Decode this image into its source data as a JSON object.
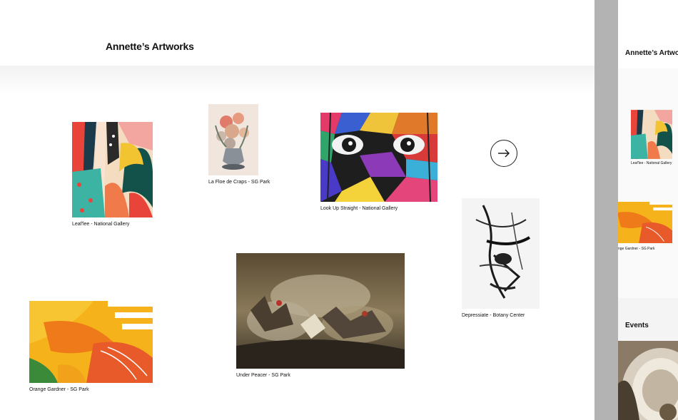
{
  "main": {
    "title": "Annette’s Artworks",
    "artworks": [
      {
        "title": "Leaf'lee",
        "location": "National Gallery",
        "caption": "Leaf'lee -  National Gallery"
      },
      {
        "title": "La Floe de Craps",
        "location": "SG Park",
        "caption": "La Floe de Craps -  SG Park"
      },
      {
        "title": "Look Up Straight",
        "location": "National Gallery",
        "caption": "Look Up Straight -  National Gallery"
      },
      {
        "title": "Depressiate",
        "location": "Botany Center",
        "caption": "Depressiate - Botany Center"
      },
      {
        "title": "Under Peacer",
        "location": "SG Park",
        "caption": "Under Peacer - SG Park"
      },
      {
        "title": "Orange Gardner",
        "location": "SG Park",
        "caption": "Orange Gardner - SG Park"
      }
    ],
    "next_icon": "arrow-right-icon"
  },
  "side_panel": {
    "title": "Annette’s Artworks",
    "caption_1": "Leaf'lee -  National Gallery",
    "caption_2": "nge Gardner - SG Park",
    "events_label": "Events"
  }
}
